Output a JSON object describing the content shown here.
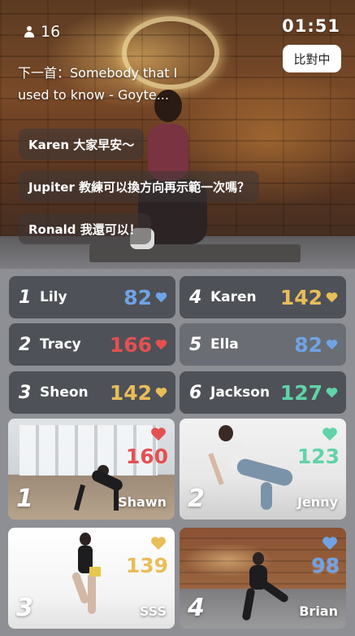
{
  "header": {
    "viewer_count": "16",
    "timer": "01:51",
    "compare_button": "比對中",
    "now_playing": "下一首：Somebody that I used to know - Goyte..."
  },
  "chat": [
    {
      "text": "Karen 大家早安～"
    },
    {
      "text": "Jupiter 教練可以換方向再示範一次嗎？"
    },
    {
      "text": "Ronald 我還可以！"
    }
  ],
  "leaderboard": [
    {
      "rank": "1",
      "name": "Lily",
      "score": "82",
      "color": "#6fa3e6"
    },
    {
      "rank": "4",
      "name": "Karen",
      "score": "142",
      "color": "#e9bd58"
    },
    {
      "rank": "2",
      "name": "Tracy",
      "score": "166",
      "color": "#e45052"
    },
    {
      "rank": "5",
      "name": "Ella",
      "score": "82",
      "color": "#6fa3e6"
    },
    {
      "rank": "3",
      "name": "Sheon",
      "score": "142",
      "color": "#e9bd58"
    },
    {
      "rank": "6",
      "name": "Jackson",
      "score": "127",
      "color": "#5fd3a9"
    }
  ],
  "tiles": [
    {
      "rank": "1",
      "name": "Shawn",
      "score": "160",
      "color": "#e45052"
    },
    {
      "rank": "2",
      "name": "Jenny",
      "score": "123",
      "color": "#5fd3a9"
    },
    {
      "rank": "3",
      "name": "SSS",
      "score": "139",
      "color": "#e9bd58"
    },
    {
      "rank": "4",
      "name": "Brian",
      "score": "98",
      "color": "#6fa3e6"
    }
  ],
  "icons": {
    "viewer": "person-icon",
    "score": "heart-icon"
  }
}
